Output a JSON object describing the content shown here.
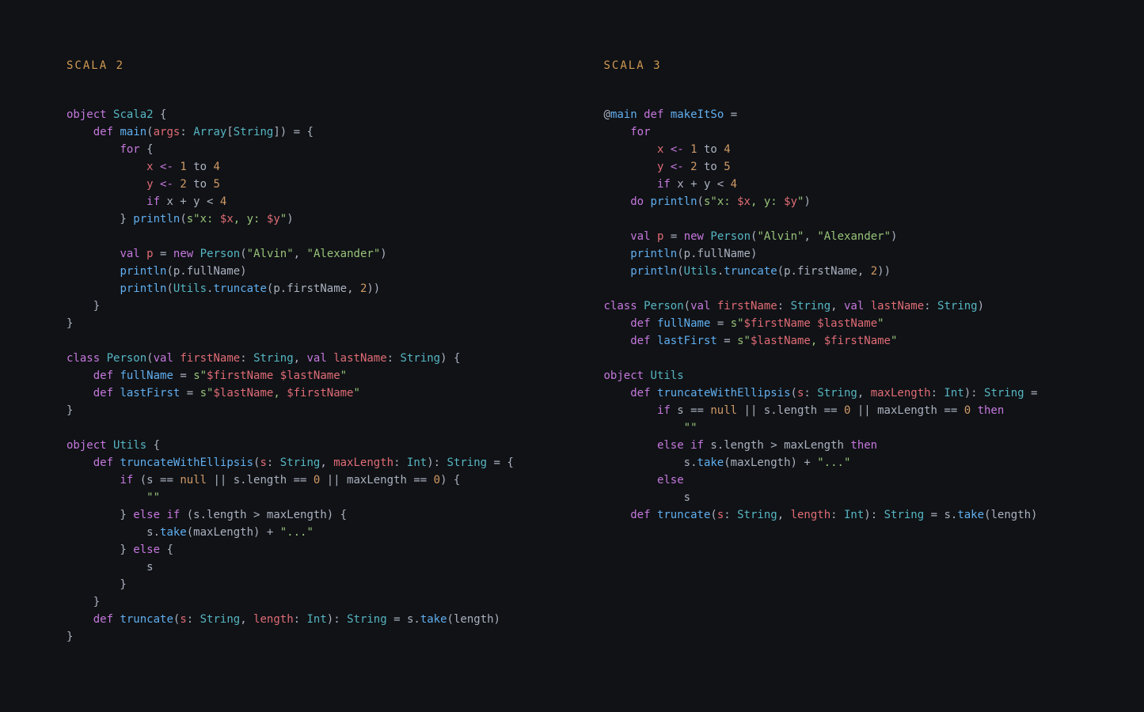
{
  "left": {
    "title": "SCALA 2",
    "lines": [
      [
        [
          "k",
          "object"
        ],
        [
          "p",
          " "
        ],
        [
          "t",
          "Scala2"
        ],
        [
          "p",
          " {"
        ]
      ],
      [
        [
          "p",
          "    "
        ],
        [
          "k",
          "def"
        ],
        [
          "p",
          " "
        ],
        [
          "fn",
          "main"
        ],
        [
          "p",
          "("
        ],
        [
          "v",
          "args"
        ],
        [
          "p",
          ": "
        ],
        [
          "t",
          "Array"
        ],
        [
          "p",
          "["
        ],
        [
          "t",
          "String"
        ],
        [
          "p",
          "]) = {"
        ]
      ],
      [
        [
          "p",
          "        "
        ],
        [
          "k",
          "for"
        ],
        [
          "p",
          " {"
        ]
      ],
      [
        [
          "p",
          "            "
        ],
        [
          "v",
          "x"
        ],
        [
          "p",
          " "
        ],
        [
          "o",
          "<-"
        ],
        [
          "p",
          " "
        ],
        [
          "n",
          "1"
        ],
        [
          "p",
          " to "
        ],
        [
          "n",
          "4"
        ]
      ],
      [
        [
          "p",
          "            "
        ],
        [
          "v",
          "y"
        ],
        [
          "p",
          " "
        ],
        [
          "o",
          "<-"
        ],
        [
          "p",
          " "
        ],
        [
          "n",
          "2"
        ],
        [
          "p",
          " to "
        ],
        [
          "n",
          "5"
        ]
      ],
      [
        [
          "p",
          "            "
        ],
        [
          "k",
          "if"
        ],
        [
          "p",
          " x + y < "
        ],
        [
          "n",
          "4"
        ]
      ],
      [
        [
          "p",
          "        } "
        ],
        [
          "fn",
          "println"
        ],
        [
          "p",
          "("
        ],
        [
          "s",
          "s\"x: "
        ],
        [
          "v",
          "$x"
        ],
        [
          "s",
          ", y: "
        ],
        [
          "v",
          "$y"
        ],
        [
          "s",
          "\""
        ],
        [
          "p",
          ")"
        ]
      ],
      [
        [
          "p",
          ""
        ]
      ],
      [
        [
          "p",
          "        "
        ],
        [
          "k",
          "val"
        ],
        [
          "p",
          " "
        ],
        [
          "v",
          "p"
        ],
        [
          "p",
          " = "
        ],
        [
          "k",
          "new"
        ],
        [
          "p",
          " "
        ],
        [
          "t",
          "Person"
        ],
        [
          "p",
          "("
        ],
        [
          "s",
          "\"Alvin\""
        ],
        [
          "p",
          ", "
        ],
        [
          "s",
          "\"Alexander\""
        ],
        [
          "p",
          ")"
        ]
      ],
      [
        [
          "p",
          "        "
        ],
        [
          "fn",
          "println"
        ],
        [
          "p",
          "(p.fullName)"
        ]
      ],
      [
        [
          "p",
          "        "
        ],
        [
          "fn",
          "println"
        ],
        [
          "p",
          "("
        ],
        [
          "t",
          "Utils"
        ],
        [
          "p",
          "."
        ],
        [
          "fn",
          "truncate"
        ],
        [
          "p",
          "(p.firstName, "
        ],
        [
          "n",
          "2"
        ],
        [
          "p",
          "))"
        ]
      ],
      [
        [
          "p",
          "    }"
        ]
      ],
      [
        [
          "p",
          "}"
        ]
      ],
      [
        [
          "p",
          ""
        ]
      ],
      [
        [
          "k",
          "class"
        ],
        [
          "p",
          " "
        ],
        [
          "t",
          "Person"
        ],
        [
          "p",
          "("
        ],
        [
          "k",
          "val"
        ],
        [
          "p",
          " "
        ],
        [
          "v",
          "firstName"
        ],
        [
          "p",
          ": "
        ],
        [
          "t",
          "String"
        ],
        [
          "p",
          ", "
        ],
        [
          "k",
          "val"
        ],
        [
          "p",
          " "
        ],
        [
          "v",
          "lastName"
        ],
        [
          "p",
          ": "
        ],
        [
          "t",
          "String"
        ],
        [
          "p",
          ") {"
        ]
      ],
      [
        [
          "p",
          "    "
        ],
        [
          "k",
          "def"
        ],
        [
          "p",
          " "
        ],
        [
          "fn",
          "fullName"
        ],
        [
          "p",
          " = "
        ],
        [
          "s",
          "s\""
        ],
        [
          "v",
          "$firstName"
        ],
        [
          "s",
          " "
        ],
        [
          "v",
          "$lastName"
        ],
        [
          "s",
          "\""
        ]
      ],
      [
        [
          "p",
          "    "
        ],
        [
          "k",
          "def"
        ],
        [
          "p",
          " "
        ],
        [
          "fn",
          "lastFirst"
        ],
        [
          "p",
          " = "
        ],
        [
          "s",
          "s\""
        ],
        [
          "v",
          "$lastName"
        ],
        [
          "s",
          ", "
        ],
        [
          "v",
          "$firstName"
        ],
        [
          "s",
          "\""
        ]
      ],
      [
        [
          "p",
          "}"
        ]
      ],
      [
        [
          "p",
          ""
        ]
      ],
      [
        [
          "k",
          "object"
        ],
        [
          "p",
          " "
        ],
        [
          "t",
          "Utils"
        ],
        [
          "p",
          " {"
        ]
      ],
      [
        [
          "p",
          "    "
        ],
        [
          "k",
          "def"
        ],
        [
          "p",
          " "
        ],
        [
          "fn",
          "truncateWithEllipsis"
        ],
        [
          "p",
          "("
        ],
        [
          "v",
          "s"
        ],
        [
          "p",
          ": "
        ],
        [
          "t",
          "String"
        ],
        [
          "p",
          ", "
        ],
        [
          "v",
          "maxLength"
        ],
        [
          "p",
          ": "
        ],
        [
          "t",
          "Int"
        ],
        [
          "p",
          "): "
        ],
        [
          "t",
          "String"
        ],
        [
          "p",
          " = {"
        ]
      ],
      [
        [
          "p",
          "        "
        ],
        [
          "k",
          "if"
        ],
        [
          "p",
          " (s == "
        ],
        [
          "n",
          "null"
        ],
        [
          "p",
          " || s.length == "
        ],
        [
          "n",
          "0"
        ],
        [
          "p",
          " || maxLength == "
        ],
        [
          "n",
          "0"
        ],
        [
          "p",
          ") {"
        ]
      ],
      [
        [
          "p",
          "            "
        ],
        [
          "s",
          "\"\""
        ]
      ],
      [
        [
          "p",
          "        } "
        ],
        [
          "k",
          "else"
        ],
        [
          "p",
          " "
        ],
        [
          "k",
          "if"
        ],
        [
          "p",
          " (s.length > maxLength) {"
        ]
      ],
      [
        [
          "p",
          "            s."
        ],
        [
          "fn",
          "take"
        ],
        [
          "p",
          "(maxLength) + "
        ],
        [
          "s",
          "\"...\""
        ]
      ],
      [
        [
          "p",
          "        } "
        ],
        [
          "k",
          "else"
        ],
        [
          "p",
          " {"
        ]
      ],
      [
        [
          "p",
          "            s"
        ]
      ],
      [
        [
          "p",
          "        }"
        ]
      ],
      [
        [
          "p",
          "    }"
        ]
      ],
      [
        [
          "p",
          "    "
        ],
        [
          "k",
          "def"
        ],
        [
          "p",
          " "
        ],
        [
          "fn",
          "truncate"
        ],
        [
          "p",
          "("
        ],
        [
          "v",
          "s"
        ],
        [
          "p",
          ": "
        ],
        [
          "t",
          "String"
        ],
        [
          "p",
          ", "
        ],
        [
          "v",
          "length"
        ],
        [
          "p",
          ": "
        ],
        [
          "t",
          "Int"
        ],
        [
          "p",
          "): "
        ],
        [
          "t",
          "String"
        ],
        [
          "p",
          " = s."
        ],
        [
          "fn",
          "take"
        ],
        [
          "p",
          "(length)"
        ]
      ],
      [
        [
          "p",
          "}"
        ]
      ]
    ]
  },
  "right": {
    "title": "SCALA 3",
    "lines": [
      [
        [
          "p",
          "@"
        ],
        [
          "fn",
          "main"
        ],
        [
          "p",
          " "
        ],
        [
          "k",
          "def"
        ],
        [
          "p",
          " "
        ],
        [
          "fn",
          "makeItSo"
        ],
        [
          "p",
          " ="
        ]
      ],
      [
        [
          "p",
          "    "
        ],
        [
          "k",
          "for"
        ]
      ],
      [
        [
          "p",
          "        "
        ],
        [
          "v",
          "x"
        ],
        [
          "p",
          " "
        ],
        [
          "o",
          "<-"
        ],
        [
          "p",
          " "
        ],
        [
          "n",
          "1"
        ],
        [
          "p",
          " to "
        ],
        [
          "n",
          "4"
        ]
      ],
      [
        [
          "p",
          "        "
        ],
        [
          "v",
          "y"
        ],
        [
          "p",
          " "
        ],
        [
          "o",
          "<-"
        ],
        [
          "p",
          " "
        ],
        [
          "n",
          "2"
        ],
        [
          "p",
          " to "
        ],
        [
          "n",
          "5"
        ]
      ],
      [
        [
          "p",
          "        "
        ],
        [
          "k",
          "if"
        ],
        [
          "p",
          " x + y < "
        ],
        [
          "n",
          "4"
        ]
      ],
      [
        [
          "p",
          "    "
        ],
        [
          "k",
          "do"
        ],
        [
          "p",
          " "
        ],
        [
          "fn",
          "println"
        ],
        [
          "p",
          "("
        ],
        [
          "s",
          "s\"x: "
        ],
        [
          "v",
          "$x"
        ],
        [
          "s",
          ", y: "
        ],
        [
          "v",
          "$y"
        ],
        [
          "s",
          "\""
        ],
        [
          "p",
          ")"
        ]
      ],
      [
        [
          "p",
          ""
        ]
      ],
      [
        [
          "p",
          "    "
        ],
        [
          "k",
          "val"
        ],
        [
          "p",
          " "
        ],
        [
          "v",
          "p"
        ],
        [
          "p",
          " = "
        ],
        [
          "k",
          "new"
        ],
        [
          "p",
          " "
        ],
        [
          "t",
          "Person"
        ],
        [
          "p",
          "("
        ],
        [
          "s",
          "\"Alvin\""
        ],
        [
          "p",
          ", "
        ],
        [
          "s",
          "\"Alexander\""
        ],
        [
          "p",
          ")"
        ]
      ],
      [
        [
          "p",
          "    "
        ],
        [
          "fn",
          "println"
        ],
        [
          "p",
          "(p.fullName)"
        ]
      ],
      [
        [
          "p",
          "    "
        ],
        [
          "fn",
          "println"
        ],
        [
          "p",
          "("
        ],
        [
          "t",
          "Utils"
        ],
        [
          "p",
          "."
        ],
        [
          "fn",
          "truncate"
        ],
        [
          "p",
          "(p.firstName, "
        ],
        [
          "n",
          "2"
        ],
        [
          "p",
          "))"
        ]
      ],
      [
        [
          "p",
          ""
        ]
      ],
      [
        [
          "k",
          "class"
        ],
        [
          "p",
          " "
        ],
        [
          "t",
          "Person"
        ],
        [
          "p",
          "("
        ],
        [
          "k",
          "val"
        ],
        [
          "p",
          " "
        ],
        [
          "v",
          "firstName"
        ],
        [
          "p",
          ": "
        ],
        [
          "t",
          "String"
        ],
        [
          "p",
          ", "
        ],
        [
          "k",
          "val"
        ],
        [
          "p",
          " "
        ],
        [
          "v",
          "lastName"
        ],
        [
          "p",
          ": "
        ],
        [
          "t",
          "String"
        ],
        [
          "p",
          ")"
        ]
      ],
      [
        [
          "p",
          "    "
        ],
        [
          "k",
          "def"
        ],
        [
          "p",
          " "
        ],
        [
          "fn",
          "fullName"
        ],
        [
          "p",
          " = "
        ],
        [
          "s",
          "s\""
        ],
        [
          "v",
          "$firstName"
        ],
        [
          "s",
          " "
        ],
        [
          "v",
          "$lastName"
        ],
        [
          "s",
          "\""
        ]
      ],
      [
        [
          "p",
          "    "
        ],
        [
          "k",
          "def"
        ],
        [
          "p",
          " "
        ],
        [
          "fn",
          "lastFirst"
        ],
        [
          "p",
          " = "
        ],
        [
          "s",
          "s\""
        ],
        [
          "v",
          "$lastName"
        ],
        [
          "s",
          ", "
        ],
        [
          "v",
          "$firstName"
        ],
        [
          "s",
          "\""
        ]
      ],
      [
        [
          "p",
          ""
        ]
      ],
      [
        [
          "k",
          "object"
        ],
        [
          "p",
          " "
        ],
        [
          "t",
          "Utils"
        ]
      ],
      [
        [
          "p",
          "    "
        ],
        [
          "k",
          "def"
        ],
        [
          "p",
          " "
        ],
        [
          "fn",
          "truncateWithEllipsis"
        ],
        [
          "p",
          "("
        ],
        [
          "v",
          "s"
        ],
        [
          "p",
          ": "
        ],
        [
          "t",
          "String"
        ],
        [
          "p",
          ", "
        ],
        [
          "v",
          "maxLength"
        ],
        [
          "p",
          ": "
        ],
        [
          "t",
          "Int"
        ],
        [
          "p",
          "): "
        ],
        [
          "t",
          "String"
        ],
        [
          "p",
          " ="
        ]
      ],
      [
        [
          "p",
          "        "
        ],
        [
          "k",
          "if"
        ],
        [
          "p",
          " s == "
        ],
        [
          "n",
          "null"
        ],
        [
          "p",
          " || s.length == "
        ],
        [
          "n",
          "0"
        ],
        [
          "p",
          " || maxLength == "
        ],
        [
          "n",
          "0"
        ],
        [
          "p",
          " "
        ],
        [
          "k",
          "then"
        ]
      ],
      [
        [
          "p",
          "            "
        ],
        [
          "s",
          "\"\""
        ]
      ],
      [
        [
          "p",
          "        "
        ],
        [
          "k",
          "else"
        ],
        [
          "p",
          " "
        ],
        [
          "k",
          "if"
        ],
        [
          "p",
          " s.length > maxLength "
        ],
        [
          "k",
          "then"
        ]
      ],
      [
        [
          "p",
          "            s."
        ],
        [
          "fn",
          "take"
        ],
        [
          "p",
          "(maxLength) + "
        ],
        [
          "s",
          "\"...\""
        ]
      ],
      [
        [
          "p",
          "        "
        ],
        [
          "k",
          "else"
        ]
      ],
      [
        [
          "p",
          "            s"
        ]
      ],
      [
        [
          "p",
          "    "
        ],
        [
          "k",
          "def"
        ],
        [
          "p",
          " "
        ],
        [
          "fn",
          "truncate"
        ],
        [
          "p",
          "("
        ],
        [
          "v",
          "s"
        ],
        [
          "p",
          ": "
        ],
        [
          "t",
          "String"
        ],
        [
          "p",
          ", "
        ],
        [
          "v",
          "length"
        ],
        [
          "p",
          ": "
        ],
        [
          "t",
          "Int"
        ],
        [
          "p",
          "): "
        ],
        [
          "t",
          "String"
        ],
        [
          "p",
          " = s."
        ],
        [
          "fn",
          "take"
        ],
        [
          "p",
          "(length)"
        ]
      ]
    ]
  }
}
